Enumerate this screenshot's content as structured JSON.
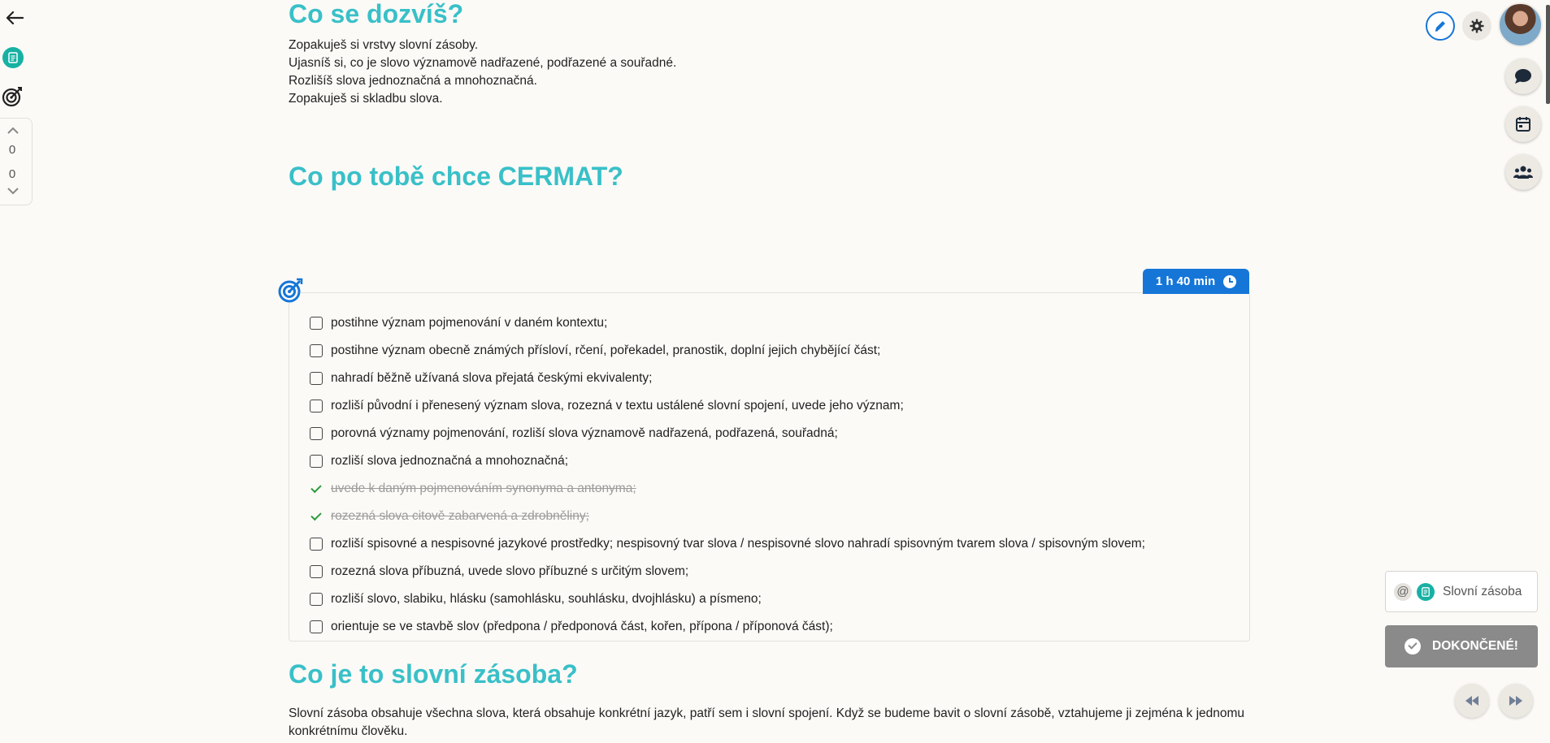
{
  "rail": {
    "vote_up_count": "0",
    "vote_down_count": "0"
  },
  "section1": {
    "title": "Co se dozvíš?",
    "lines": [
      "Zopakuješ si vrstvy slovní zásoby.",
      "Ujasníš si, co je slovo významově nadřazené, podřazené a souřadné.",
      "Rozlišíš slova jednoznačná a mnohoznačná.",
      "Zopakuješ si skladbu slova."
    ]
  },
  "section2": {
    "title": "Co po tobě chce CERMAT?"
  },
  "objectives": {
    "time": "1 h 40 min",
    "items": [
      {
        "text": "postihne význam pojmenování v daném kontextu;",
        "done": false
      },
      {
        "text": "postihne význam obecně známých přísloví, rčení, pořekadel, pranostik, doplní jejich chybějící část;",
        "done": false
      },
      {
        "text": "nahradí běžně užívaná slova přejatá českými ekvivalenty;",
        "done": false
      },
      {
        "text": "rozliší původní i přenesený význam slova, rozezná v textu ustálené slovní spojení, uvede jeho význam;",
        "done": false
      },
      {
        "text": "porovná významy pojmenování, rozliší slova významově nadřazená, podřazená, souřadná;",
        "done": false
      },
      {
        "text": "rozliší slova jednoznačná a mnohoznačná;",
        "done": false
      },
      {
        "text": "uvede k daným pojmenováním synonyma a antonyma;",
        "done": true
      },
      {
        "text": "rozezná slova citově zabarvená a zdrobněliny;",
        "done": true
      },
      {
        "text": "rozliší spisovné a nespisovné jazykové prostředky; nespisovný tvar slova / nespisovné slovo nahradí spisovným tvarem slova / spisovným slovem;",
        "done": false
      },
      {
        "text": "rozezná slova příbuzná, uvede slovo příbuzné s určitým slovem;",
        "done": false
      },
      {
        "text": "rozliší slovo, slabiku, hlásku (samohlásku, souhlásku, dvojhlásku) a písmeno;",
        "done": false
      },
      {
        "text": "orientuje se ve stavbě slov (předpona / předponová část, kořen, přípona / příponová část);",
        "done": false
      }
    ]
  },
  "section3": {
    "title": "Co je to slovní zásoba?",
    "paragraph": "Slovní zásoba obsahuje všechna slova, která obsahuje konkrétní jazyk, patří sem i slovní spojení. Když se budeme bavit o slovní zásobě, vztahujeme ji zejména k jednomu konkrétnímu člověku."
  },
  "widgets": {
    "tag_label": "Slovní zásoba",
    "at_symbol": "@",
    "done_label": "DOKONČENÉ!"
  },
  "colors": {
    "heading": "#39c0c8",
    "accent": "#1576d8",
    "doc": "#17b1a4",
    "done_check": "#2a9d3d"
  }
}
